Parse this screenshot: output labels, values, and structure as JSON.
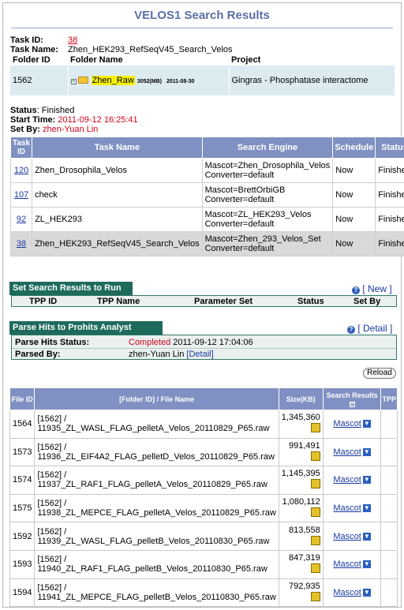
{
  "title": "VELOS1 Search Results",
  "task": {
    "id_label": "Task ID:",
    "id_value": "38",
    "name_label": "Task Name:",
    "name_value": "Zhen_HEK293_RefSeqV45_Search_Velos"
  },
  "folder": {
    "headers": [
      "Folder ID",
      "Folder Name",
      "Project"
    ],
    "id": "1562",
    "name": "Zhen_Raw",
    "size": "3052(MB)",
    "date": "2011-08-30",
    "project": "Gingras - Phosphatase interactome"
  },
  "status": {
    "status_label": "Status",
    "status_value": ": Finished",
    "start_label": "Start Time:",
    "start_value": "2011-09-12 16:25:41",
    "setby_label": "Set By:",
    "setby_value": "zhen-Yuan Lin"
  },
  "tasks_table": {
    "headers": [
      "Task ID",
      "Task Name",
      "Search Engine",
      "Schedule",
      "Status"
    ],
    "rows": [
      {
        "id": "120",
        "name": "Zhen_Drosophila_Velos",
        "engine1": "Mascot=Zhen_Drosophila_Velos",
        "engine2": "Converter=default",
        "schedule": "Now",
        "status": "Finished"
      },
      {
        "id": "107",
        "name": "check",
        "engine1": "Mascot=BrettOrbiGB",
        "engine2": "Converter=default",
        "schedule": "Now",
        "status": "Finished"
      },
      {
        "id": "92",
        "name": "ZL_HEK293",
        "engine1": "Mascot=ZL_HEK293_Velos",
        "engine2": "Converter=default",
        "schedule": "Now",
        "status": "Finished"
      },
      {
        "id": "38",
        "name": "Zhen_HEK293_RefSeqV45_Search_Velos",
        "engine1": "Mascot=Zhen_293_Velos_Set",
        "engine2": "Converter=default",
        "schedule": "Now",
        "status": "Finished"
      }
    ]
  },
  "tpp_section": {
    "title": "Set Search Results to Run TPP",
    "new_link": "[ New ]",
    "headers": [
      "TPP ID",
      "TPP Name",
      "Parameter Set",
      "Status",
      "Set By"
    ]
  },
  "parse_section": {
    "title": "Parse Hits to Prohits Analyst database",
    "detail_link": "[ Detail ]",
    "status_label": "Parse Hits Status:",
    "status_value": "Completed",
    "status_time": "2011-09-12 17:04:06",
    "parsed_label": "Parsed By:",
    "parsed_value": "zhen-Yuan Lin",
    "parsed_link": "[Detail]"
  },
  "reload_label": "Reload",
  "files_table": {
    "headers": {
      "file_id": "File ID",
      "name": "[Folder ID] / File Name",
      "size": "Size(KB)",
      "results": "Search Results",
      "tpp": "TPP"
    },
    "result_link": "Mascot",
    "rows": [
      {
        "id": "1564",
        "folder": "[1562] /",
        "file": "11935_ZL_WASL_FLAG_pelletA_Velos_20110829_P65.raw",
        "size": "1,345,360"
      },
      {
        "id": "1573",
        "folder": "[1562] /",
        "file": "11936_ZL_EIF4A2_FLAG_pelletD_Velos_20110829_P65.raw",
        "size": "991,491"
      },
      {
        "id": "1574",
        "folder": "[1562] /",
        "file": "11937_ZL_RAF1_FLAG_pelletA_Velos_20110829_P65.raw",
        "size": "1,145,395"
      },
      {
        "id": "1575",
        "folder": "[1562] /",
        "file": "11938_ZL_MEPCE_FLAG_pelletA_Velos_20110829_P65.raw",
        "size": "1,080,112"
      },
      {
        "id": "1592",
        "folder": "[1562] /",
        "file": "11939_ZL_WASL_FLAG_pelletB_Velos_20110830_P65.raw",
        "size": "813,558"
      },
      {
        "id": "1593",
        "folder": "[1562] /",
        "file": "11940_ZL_RAF1_FLAG_pelletB_Velos_20110830_P65.raw",
        "size": "847,319"
      },
      {
        "id": "1594",
        "folder": "[1562] /",
        "file": "11941_ZL_MEPCE_FLAG_pelletB_Velos_20110830_P65.raw",
        "size": "792,935"
      }
    ]
  }
}
